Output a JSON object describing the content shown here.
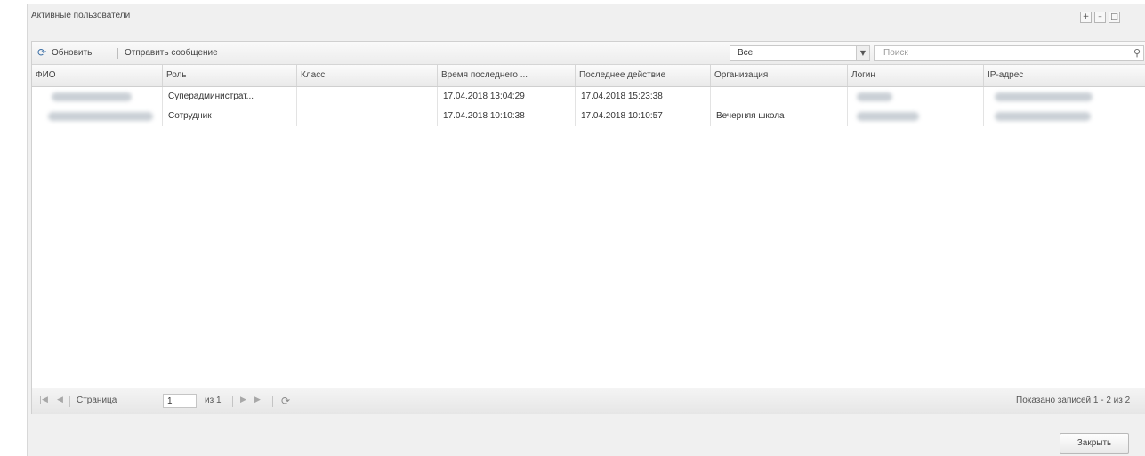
{
  "window": {
    "title": "Активные пользователи",
    "controls": [
      "+",
      "–",
      "□"
    ]
  },
  "toolbar": {
    "refresh_label": "Обновить",
    "send_message_label": "Отправить сообщение",
    "filter_value": "Все",
    "search_placeholder": "Поиск"
  },
  "grid": {
    "columns": [
      "ФИО",
      "Роль",
      "Класс",
      "Время последнего ...",
      "Последнее действие",
      "Организация",
      "Логин",
      "IP-адрес"
    ],
    "rows": [
      {
        "fio": "",
        "role": "Суперадминистрат...",
        "class": "",
        "last_time": "17.04.2018 13:04:29",
        "last_action": "17.04.2018 15:23:38",
        "org": "",
        "login": "",
        "ip": ""
      },
      {
        "fio": "",
        "role": "Сотрудник",
        "class": "",
        "last_time": "17.04.2018 10:10:38",
        "last_action": "17.04.2018 10:10:57",
        "org": "Вечерняя школа",
        "login": "",
        "ip": ""
      }
    ]
  },
  "paging": {
    "page_label": "Страница",
    "page_value": "1",
    "of_label": "из 1",
    "summary": "Показано записей 1 - 2 из 2"
  },
  "footer": {
    "close_label": "Закрыть"
  },
  "icons": {
    "refresh": "refresh-icon",
    "search": "search-icon",
    "first": "first-page-icon",
    "prev": "prev-page-icon",
    "next": "next-page-icon",
    "last": "last-page-icon"
  }
}
